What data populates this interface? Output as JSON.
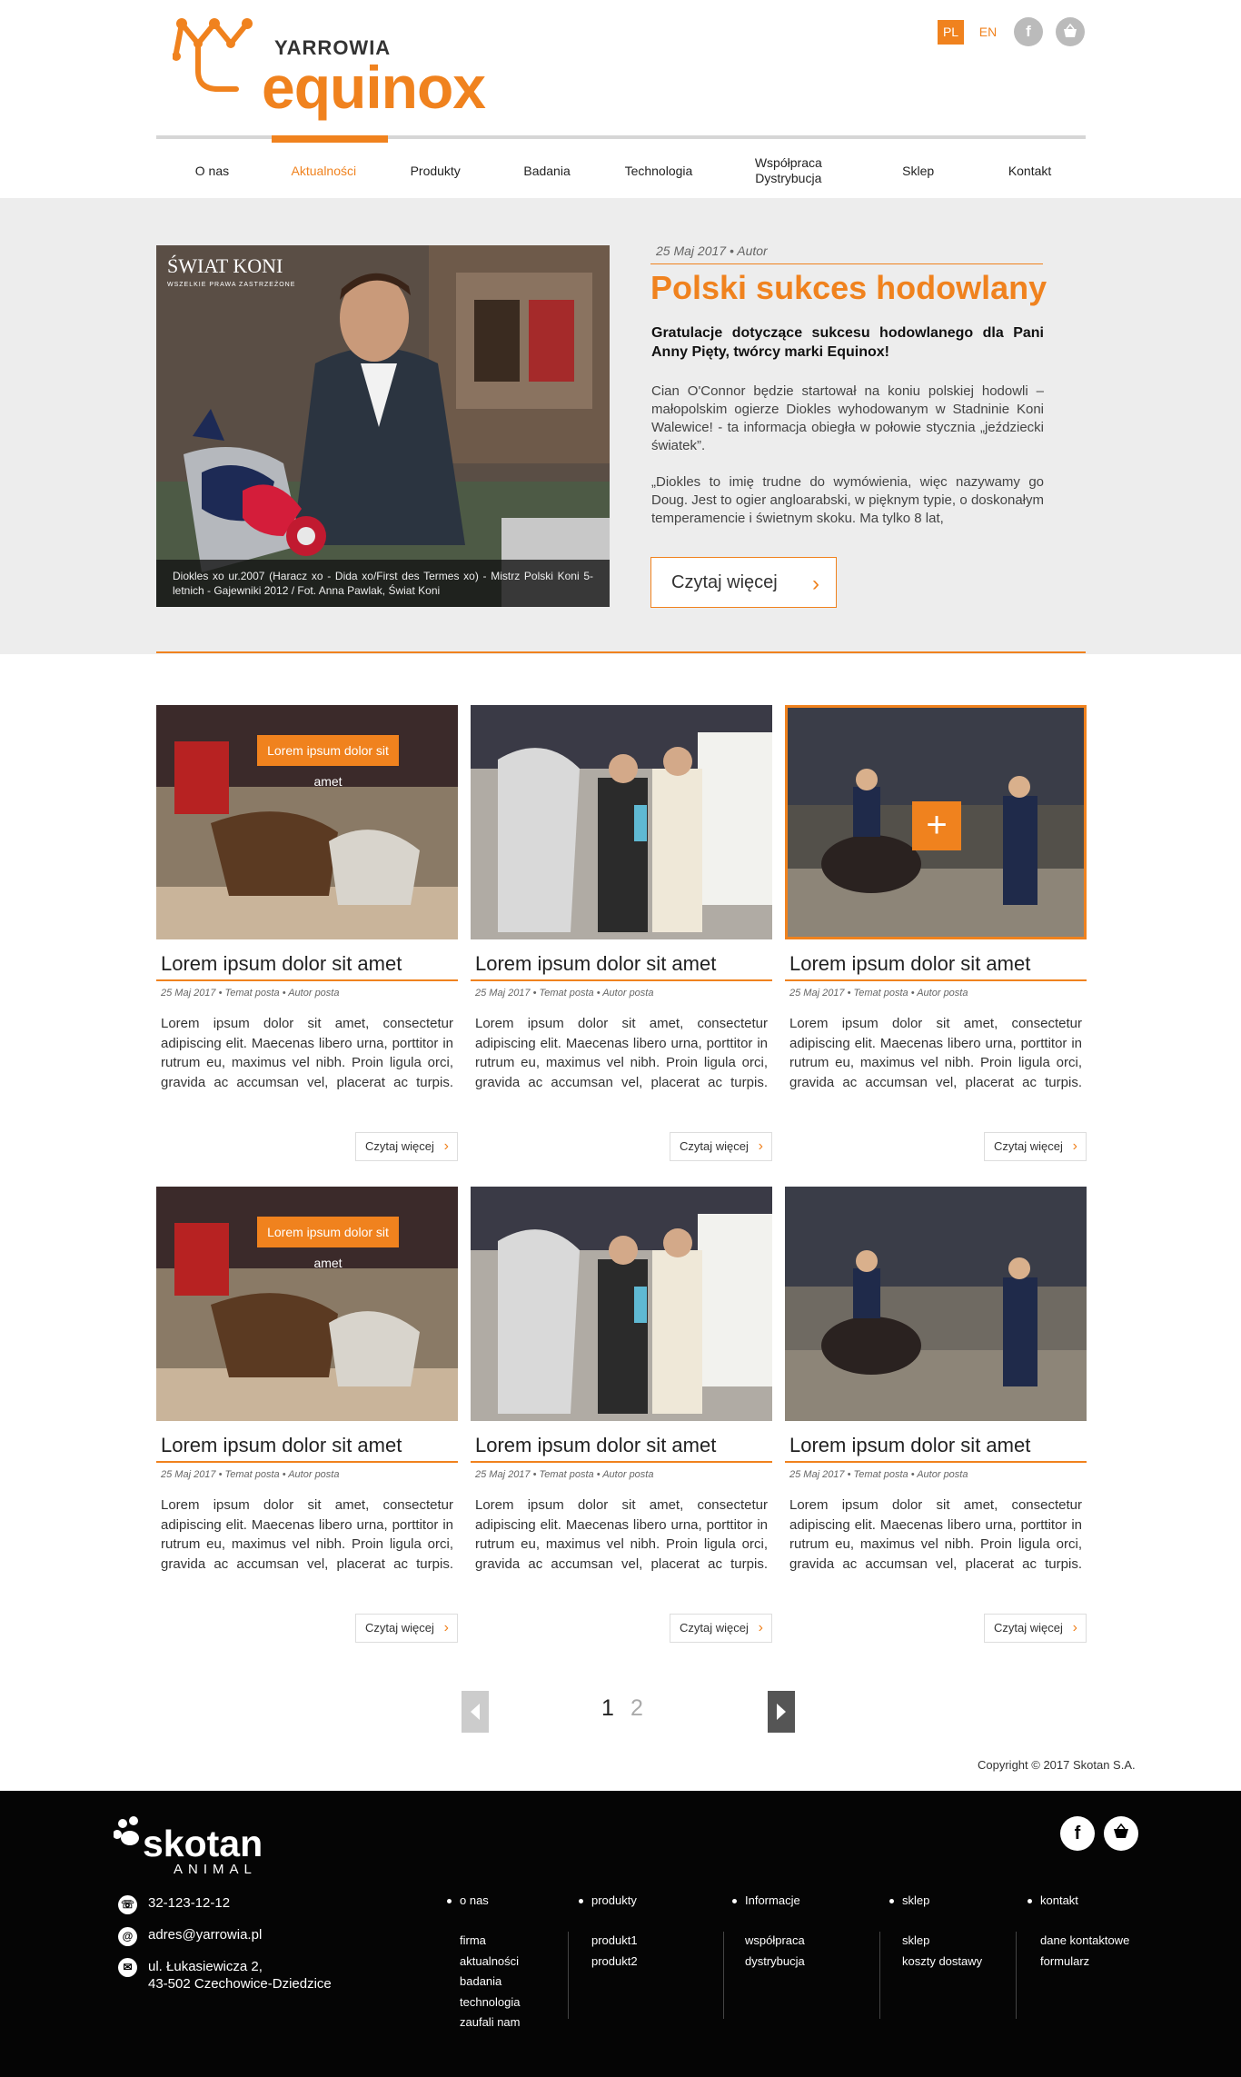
{
  "header": {
    "logo_small": "YARROWIA",
    "logo_big": "equinox",
    "lang_active": "PL",
    "lang_other": "EN",
    "facebook_icon": "facebook-icon",
    "cart_icon": "shop-basket-icon"
  },
  "nav": {
    "items": [
      "O nas",
      "Aktualności",
      "Produkty",
      "Badania",
      "Technologia",
      "Współpraca Dystrybucja",
      "Sklep",
      "Kontakt"
    ],
    "active_index": 1
  },
  "hero": {
    "image_logo": "ŚWIAT KONI",
    "image_logo_sub": "WSZELKIE PRAWA ZASTRZEŻONE",
    "caption": "Diokles xo ur.2007 (Haracz xo - Dida xo/First des Termes xo) - Mistrz Polski Koni 5-letnich - Gajewniki 2012 / Fot. Anna Pawlak, Świat Koni",
    "date": "25 Maj 2017",
    "author": "Autor",
    "title": "Polski sukces hodowlany",
    "lead": "Gratulacje dotyczące sukcesu hodowlanego dla Pani Anny Pięty, twórcy marki Equinox!",
    "para1": "Cian O'Connor będzie startował na koniu polskiej hodowli – małopolskim ogierze Diokles wyhodowanym w Stadninie Koni Walewice! - ta informacja obiegła w połowie stycznia „jeździecki światek”.",
    "para2": "„Diokles to imię trudne do wymówienia, więc nazywamy go Doug. Jest to ogier angloarabski, w pięknym typie, o doskonałym temperamencie i świetnym skoku. Ma tylko 8 lat,",
    "read_more": "Czytaj więcej"
  },
  "cards": [
    {
      "title": "Lorem ipsum dolor sit amet",
      "date": "25 Maj 2017",
      "topic": "Temat posta",
      "author": "Autor posta",
      "text": "Lorem ipsum dolor sit amet, consectetur adipiscing elit. Maecenas libero urna, porttitor in rutrum eu, maximus vel nibh. Proin ligula orci, gravida ac accumsan vel, placerat ac turpis. Donec ut dui ac magna",
      "button": "Czytaj więcej",
      "badge": "Lorem ipsum dolor sit amet"
    },
    {
      "title": "Lorem ipsum dolor sit amet",
      "date": "25 Maj 2017",
      "topic": "Temat posta",
      "author": "Autor posta",
      "text": "Lorem ipsum dolor sit amet, consectetur adipiscing elit. Maecenas libero urna, porttitor in rutrum eu, maximus vel nibh. Proin ligula orci, gravida ac accumsan vel, placerat ac turpis. Donec ut dui ac magna",
      "button": "Czytaj więcej"
    },
    {
      "title": "Lorem ipsum dolor sit amet",
      "date": "25 Maj 2017",
      "topic": "Temat posta",
      "author": "Autor posta",
      "text": "Lorem ipsum dolor sit amet, consectetur adipiscing elit. Maecenas libero urna, porttitor in rutrum eu, maximus vel nibh. Proin ligula orci, gravida ac accumsan vel, placerat ac turpis. Donec ut dui ac magna",
      "button": "Czytaj więcej",
      "plus": "+"
    },
    {
      "title": "Lorem ipsum dolor sit amet",
      "date": "25 Maj 2017",
      "topic": "Temat posta",
      "author": "Autor posta",
      "text": "Lorem ipsum dolor sit amet, consectetur adipiscing elit. Maecenas libero urna, porttitor in rutrum eu, maximus vel nibh. Proin ligula orci, gravida ac accumsan vel, placerat ac turpis. Donec ut dui ac magna",
      "button": "Czytaj więcej",
      "badge": "Lorem ipsum dolor sit amet"
    },
    {
      "title": "Lorem ipsum dolor sit amet",
      "date": "25 Maj 2017",
      "topic": "Temat posta",
      "author": "Autor posta",
      "text": "Lorem ipsum dolor sit amet, consectetur adipiscing elit. Maecenas libero urna, porttitor in rutrum eu, maximus vel nibh. Proin ligula orci, gravida ac accumsan vel, placerat ac turpis. Donec ut dui ac magna",
      "button": "Czytaj więcej"
    },
    {
      "title": "Lorem ipsum dolor sit amet",
      "date": "25 Maj 2017",
      "topic": "Temat posta",
      "author": "Autor posta",
      "text": "Lorem ipsum dolor sit amet, consectetur adipiscing elit. Maecenas libero urna, porttitor in rutrum eu, maximus vel nibh. Proin ligula orci, gravida ac accumsan vel, placerat ac turpis. Donec ut dui ac magna",
      "button": "Czytaj więcej"
    }
  ],
  "pagination": {
    "pages": [
      "1",
      "2"
    ],
    "current": "1"
  },
  "copyright": "Copyright © 2017 Skotan S.A.",
  "footer": {
    "logo_word": "skotan",
    "logo_sub": "ANIMAL",
    "phone": "32-123-12-12",
    "email": "adres@yarrowia.pl",
    "address_line1": "ul. Łukasiewicza 2,",
    "address_line2": "43-502 Czechowice-Dziedzice",
    "columns": [
      {
        "head": "o nas",
        "links": [
          "firma",
          "aktualności",
          "badania",
          "technologia",
          "zaufali nam"
        ]
      },
      {
        "head": "produkty",
        "links": [
          "produkt1",
          "produkt2"
        ]
      },
      {
        "head": "Informacje",
        "links": [
          "współpraca",
          "dystrybucja"
        ]
      },
      {
        "head": "sklep",
        "links": [
          "sklep",
          "koszty dostawy"
        ]
      },
      {
        "head": "kontakt",
        "links": [
          "dane kontaktowe",
          "formularz"
        ]
      }
    ],
    "shop_label": "sklep"
  },
  "colors": {
    "accent": "#f0821e",
    "footer_bg": "#050505",
    "hero_bg": "#ededed"
  }
}
